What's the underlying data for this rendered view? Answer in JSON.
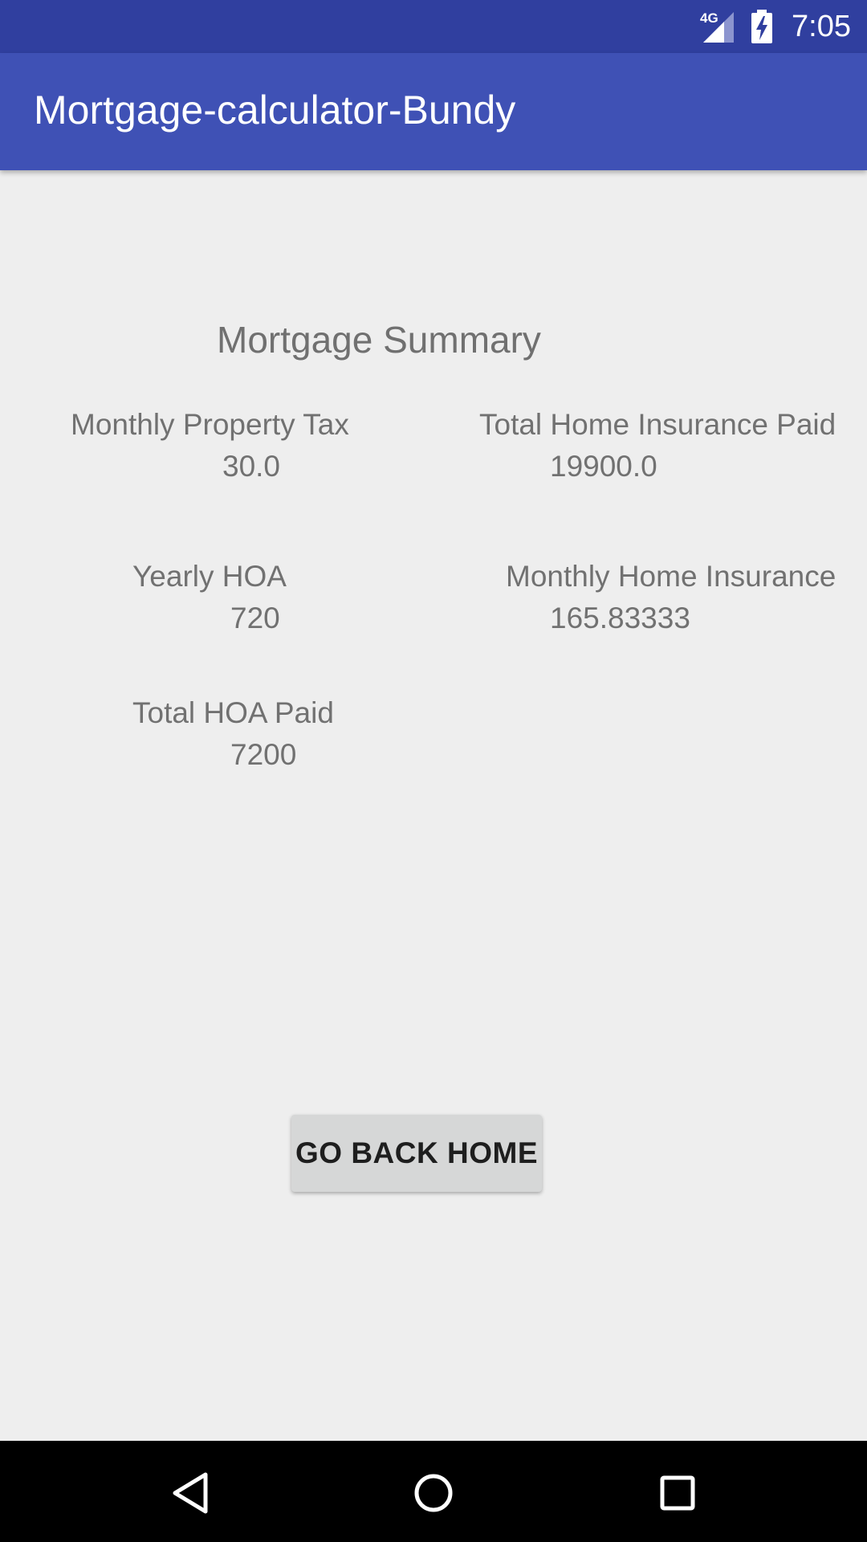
{
  "status_bar": {
    "network_type": "4G",
    "time": "7:05",
    "icons": [
      "signal-icon",
      "battery-charging-icon"
    ]
  },
  "app_bar": {
    "title": "Mortgage-calculator-Bundy",
    "color": "#3f51b5",
    "status_color": "#303f9f"
  },
  "summary": {
    "heading": "Mortgage Summary",
    "monthly_property_tax": {
      "label": "Monthly Property Tax",
      "value": "30.0"
    },
    "total_home_insurance_paid": {
      "label": "Total Home Insurance Paid",
      "value": "19900.0"
    },
    "yearly_hoa": {
      "label": "Yearly HOA",
      "value": "720"
    },
    "monthly_home_insurance": {
      "label": "Monthly Home Insurance",
      "value": "165.83333"
    },
    "total_hoa_paid": {
      "label": "Total HOA Paid",
      "value": "7200"
    }
  },
  "actions": {
    "go_back_home": "GO BACK HOME"
  },
  "nav_bar": {
    "icons": [
      "back-icon",
      "home-icon",
      "recents-icon"
    ]
  }
}
